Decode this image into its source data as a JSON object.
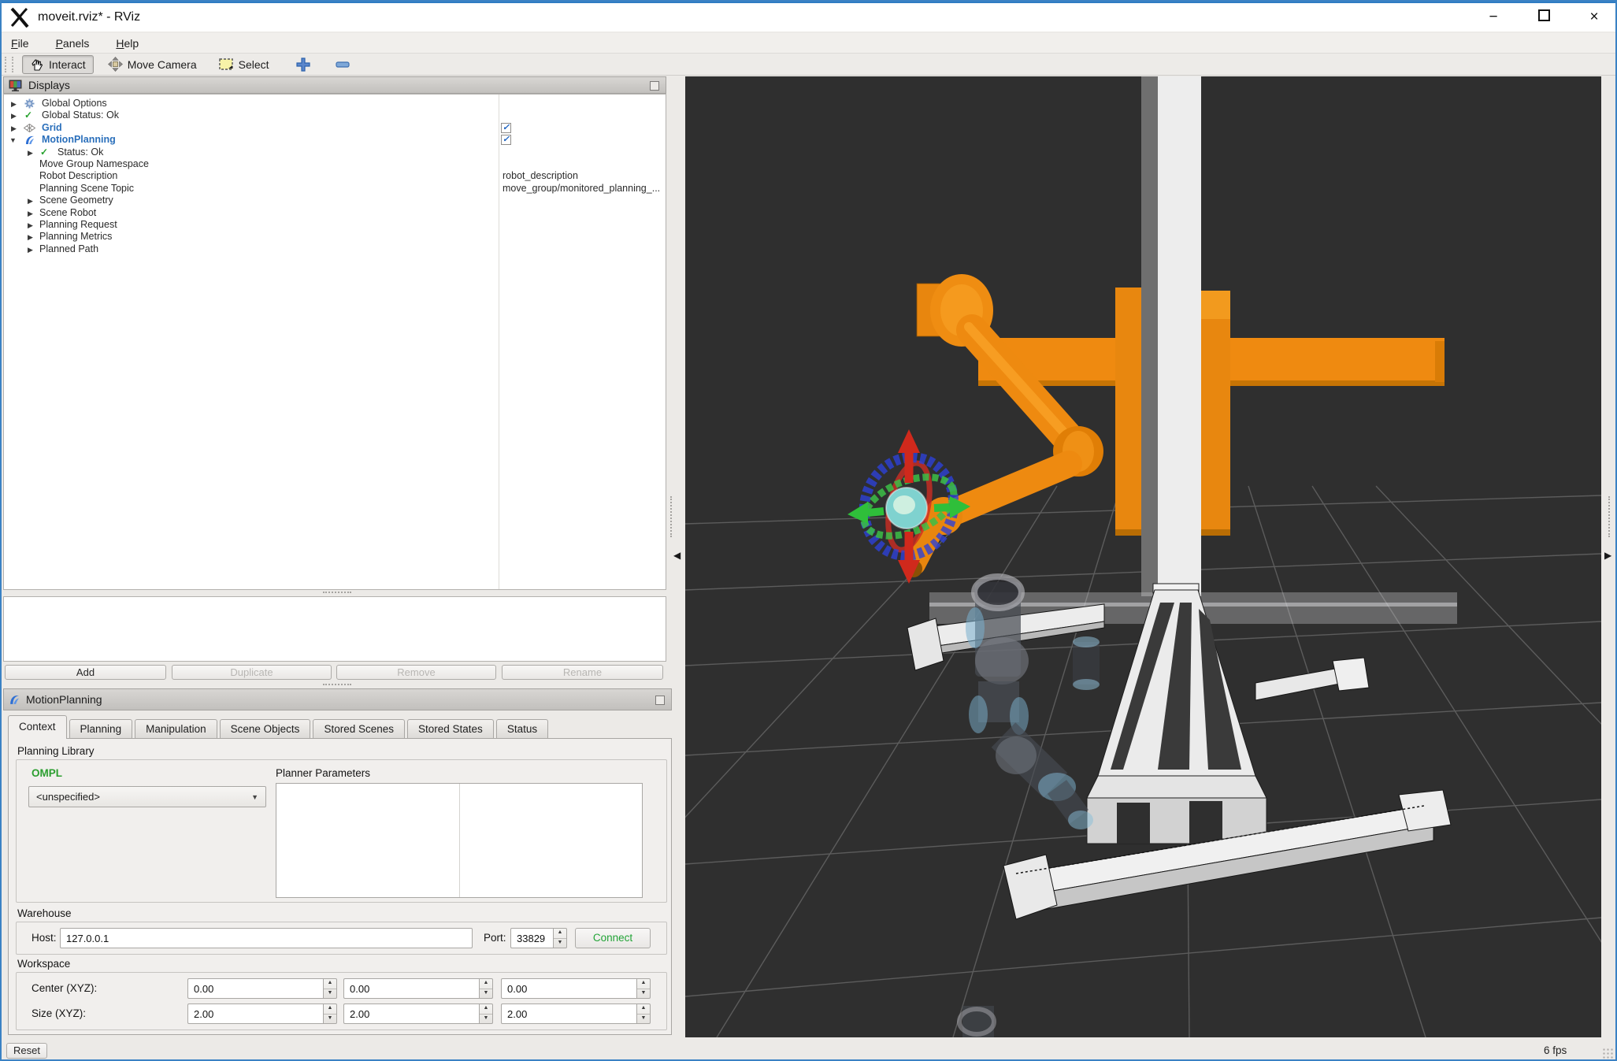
{
  "window": {
    "title": "moveit.rviz* - RViz"
  },
  "icons": {
    "expander_collapsed": "▶",
    "expander_expanded": "▼",
    "status_check": "✓",
    "checkbox_check": "✓",
    "spin_up": "▲",
    "spin_down": "▼",
    "dropdown_arrow": "▼",
    "panel_collapse_left": "◀",
    "panel_collapse_right": "▶",
    "minimize": "−",
    "close": "×"
  },
  "menu": {
    "file": "File",
    "panels": "Panels",
    "help": "Help"
  },
  "toolbar": {
    "interact": "Interact",
    "move_camera": "Move Camera",
    "select": "Select"
  },
  "displays": {
    "title": "Displays",
    "rows": [
      {
        "label": "Global Options"
      },
      {
        "label": "Global Status: Ok"
      },
      {
        "label": "Grid"
      },
      {
        "label": "MotionPlanning"
      },
      {
        "label": "Status: Ok"
      },
      {
        "label": "Move Group Namespace"
      },
      {
        "label": "Robot Description",
        "value": "robot_description"
      },
      {
        "label": "Planning Scene Topic",
        "value": "move_group/monitored_planning_..."
      },
      {
        "label": "Scene Geometry"
      },
      {
        "label": "Scene Robot"
      },
      {
        "label": "Planning Request"
      },
      {
        "label": "Planning Metrics"
      },
      {
        "label": "Planned Path"
      }
    ],
    "buttons": {
      "add": "Add",
      "duplicate": "Duplicate",
      "remove": "Remove",
      "rename": "Rename"
    }
  },
  "motion_planning": {
    "title": "MotionPlanning",
    "tabs": {
      "context": "Context",
      "planning": "Planning",
      "manipulation": "Manipulation",
      "scene_objects": "Scene Objects",
      "stored_scenes": "Stored Scenes",
      "stored_states": "Stored States",
      "status": "Status"
    },
    "planning_library": {
      "heading": "Planning Library",
      "library_name": "OMPL",
      "selected_planner": "<unspecified>",
      "planner_parameters_label": "Planner Parameters"
    },
    "warehouse": {
      "heading": "Warehouse",
      "host_label": "Host:",
      "host_value": "127.0.0.1",
      "port_label": "Port:",
      "port_value": "33829",
      "connect_button": "Connect"
    },
    "workspace": {
      "heading": "Workspace",
      "center_label": "Center (XYZ):",
      "size_label": "Size (XYZ):",
      "center_values": [
        "0.00",
        "0.00",
        "0.00"
      ],
      "size_values": [
        "2.00",
        "2.00",
        "2.00"
      ]
    }
  },
  "status_bar": {
    "reset_button": "Reset",
    "fps": "6 fps"
  },
  "colors": {
    "accent_blue": "#2a6fbb",
    "status_green": "#27a22e",
    "library_green": "#2b9e2f",
    "connect_green": "#22a437",
    "robot_orange": "#ef8a10",
    "viewport_bg": "#2f2f2f"
  }
}
